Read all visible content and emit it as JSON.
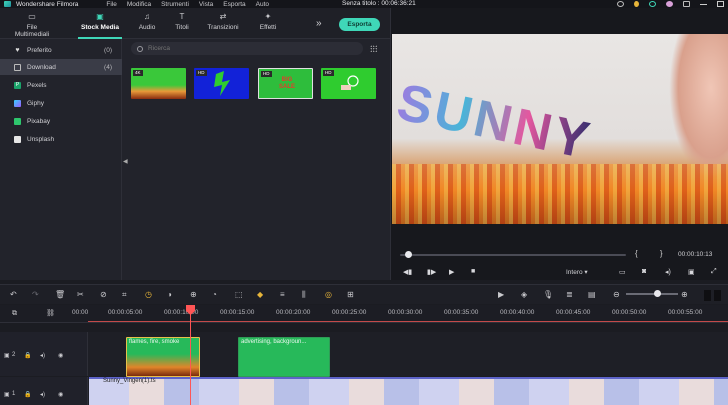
{
  "titlebar": {
    "app_name": "Wondershare Filmora",
    "menu": [
      "File",
      "Modifica",
      "Strumenti",
      "Vista",
      "Esporta",
      "Auto"
    ],
    "document_title": "Senza titolo : 00:06:36:21"
  },
  "tabs": [
    {
      "label": "File Multimediali",
      "icon": "folder-icon"
    },
    {
      "label": "Stock Media",
      "icon": "stock-media-icon",
      "active": true
    },
    {
      "label": "Audio",
      "icon": "music-note-icon"
    },
    {
      "label": "Titoli",
      "icon": "text-icon"
    },
    {
      "label": "Transizioni",
      "icon": "transition-icon"
    },
    {
      "label": "Effetti",
      "icon": "effects-icon"
    }
  ],
  "export_label": "Esporta",
  "sidebar": {
    "items": [
      {
        "label": "Preferito",
        "count": "(0)",
        "icon": "heart-icon"
      },
      {
        "label": "Download",
        "count": "(4)",
        "icon": "folder-icon",
        "active": true
      },
      {
        "label": "Pexels",
        "icon": "pexels-icon"
      },
      {
        "label": "Giphy",
        "icon": "giphy-icon"
      },
      {
        "label": "Pixabay",
        "icon": "pixabay-icon"
      },
      {
        "label": "Unsplash",
        "icon": "unsplash-icon"
      }
    ]
  },
  "search": {
    "placeholder": "Ricerca"
  },
  "thumbnails": [
    {
      "badge": "4K"
    },
    {
      "badge": "HD"
    },
    {
      "badge": "HD",
      "text": "BIG SALE"
    },
    {
      "badge": "HD"
    }
  ],
  "preview": {
    "video_text": "SUNNY",
    "braces": "{ }",
    "current_time": "00:00:10:13",
    "quality": "Intero"
  },
  "ruler": {
    "labels": [
      "00:00",
      "00:00:05:00",
      "00:00:10:00",
      "00:00:15:00",
      "00:00:20:00",
      "00:00:25:00",
      "00:00:30:00",
      "00:00:35:00",
      "00:00:40:00",
      "00:00:45:00",
      "00:00:50:00",
      "00:00:55:00"
    ]
  },
  "tracks": {
    "track2_label": "2",
    "track1_label": "1",
    "clips": [
      {
        "label": "flames, fire, smoke"
      },
      {
        "label": "advertising, backgroun..."
      },
      {
        "label": "Sunny_Vingen(1).ts"
      }
    ]
  },
  "colors": {
    "accent": "#3fd7b8",
    "playhead": "#ff5555",
    "clip_green": "#27b95a",
    "clip_video": "#5d63c9"
  }
}
